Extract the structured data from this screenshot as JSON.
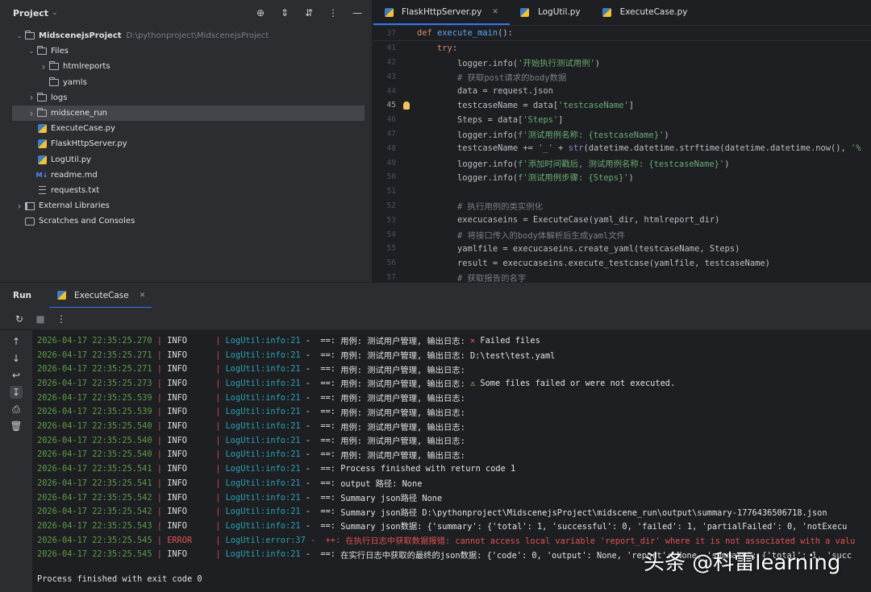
{
  "project": {
    "title": "Project",
    "tree": [
      {
        "label": "MidscenejsProject",
        "path": "D:\\pythonproject\\MidscenejsProject",
        "level": 0,
        "expand": "down",
        "icon": "folder"
      },
      {
        "label": "Files",
        "level": 1,
        "expand": "down",
        "icon": "folder"
      },
      {
        "label": "htmlreports",
        "level": 2,
        "expand": "right",
        "icon": "folder"
      },
      {
        "label": "yamls",
        "level": 2,
        "expand": "none",
        "icon": "folder"
      },
      {
        "label": "logs",
        "level": 1,
        "expand": "right",
        "icon": "folder"
      },
      {
        "label": "midscene_run",
        "level": 1,
        "expand": "right",
        "icon": "folder",
        "selected": true
      },
      {
        "label": "ExecuteCase.py",
        "level": 1,
        "expand": "none",
        "icon": "python"
      },
      {
        "label": "FlaskHttpServer.py",
        "level": 1,
        "expand": "none",
        "icon": "python"
      },
      {
        "label": "LogUtil.py",
        "level": 1,
        "expand": "none",
        "icon": "python"
      },
      {
        "label": "readme.md",
        "level": 1,
        "expand": "none",
        "icon": "markdown"
      },
      {
        "label": "requests.txt",
        "level": 1,
        "expand": "none",
        "icon": "text"
      },
      {
        "label": "External Libraries",
        "level": 0,
        "expand": "right",
        "icon": "library"
      },
      {
        "label": "Scratches and Consoles",
        "level": 0,
        "expand": "none",
        "icon": "scratch"
      }
    ]
  },
  "editor": {
    "tabs": [
      {
        "label": "FlaskHttpServer.py",
        "active": true,
        "closable": true
      },
      {
        "label": "LogUtil.py",
        "active": false,
        "closable": false
      },
      {
        "label": "ExecuteCase.py",
        "active": false,
        "closable": false
      }
    ],
    "sticky": {
      "line": "37",
      "def_kw": "def",
      "fname": "execute_main",
      "rest": "():"
    },
    "lines": [
      {
        "n": "41",
        "code": "    try:"
      },
      {
        "n": "42",
        "code": "        logger.info('开始执行测试用例')"
      },
      {
        "n": "43",
        "code": "        # 获取post请求的body数据"
      },
      {
        "n": "44",
        "code": "        data = request.json"
      },
      {
        "n": "45",
        "code": "        testcaseName = data['testcaseName']",
        "current": true
      },
      {
        "n": "46",
        "code": "        Steps = data['Steps']"
      },
      {
        "n": "47",
        "code": "        logger.info(f'测试用例名称: {testcaseName}')"
      },
      {
        "n": "48",
        "code": "        testcaseName += '_' + str(datetime.datetime.strftime(datetime.datetime.now(), '%"
      },
      {
        "n": "49",
        "code": "        logger.info(f'添加时间戳后, 测试用例名称: {testcaseName}')"
      },
      {
        "n": "50",
        "code": "        logger.info(f'测试用例步骤: {Steps}')"
      },
      {
        "n": "51",
        "code": ""
      },
      {
        "n": "52",
        "code": "        # 执行用例的类实例化"
      },
      {
        "n": "53",
        "code": "        execucaseins = ExecuteCase(yaml_dir, htmlreport_dir)"
      },
      {
        "n": "54",
        "code": "        # 将接口传入的body体解析后生成yaml文件"
      },
      {
        "n": "55",
        "code": "        yamlfile = execucaseins.create_yaml(testcaseName, Steps)"
      },
      {
        "n": "56",
        "code": "        result = execucaseins.execute_testcase(yamlfile, testcaseName)"
      },
      {
        "n": "57",
        "code": "        # 获取报告的名字"
      }
    ]
  },
  "run": {
    "label": "Run",
    "tab": "ExecuteCase",
    "log": [
      {
        "ts": "2026-04-17 22:35:25.270",
        "level": "INFO",
        "loc": "LogUtil:info:21",
        "sep": "-  ==:",
        "msg": "用例: 测试用户管理, 输出日志:",
        "icon": "x",
        "extra": "Failed files"
      },
      {
        "ts": "2026-04-17 22:35:25.271",
        "level": "INFO",
        "loc": "LogUtil:info:21",
        "sep": "-  ==:",
        "msg": "用例: 测试用户管理, 输出日志: D:\\test\\test.yaml"
      },
      {
        "ts": "2026-04-17 22:35:25.271",
        "level": "INFO",
        "loc": "LogUtil:info:21",
        "sep": "-  ==:",
        "msg": "用例: 测试用户管理, 输出日志:"
      },
      {
        "ts": "2026-04-17 22:35:25.273",
        "level": "INFO",
        "loc": "LogUtil:info:21",
        "sep": "-  ==:",
        "msg": "用例: 测试用户管理, 输出日志:",
        "icon": "warn",
        "extra": "Some files failed or were not executed."
      },
      {
        "ts": "2026-04-17 22:35:25.539",
        "level": "INFO",
        "loc": "LogUtil:info:21",
        "sep": "-  ==:",
        "msg": "用例: 测试用户管理, 输出日志:"
      },
      {
        "ts": "2026-04-17 22:35:25.539",
        "level": "INFO",
        "loc": "LogUtil:info:21",
        "sep": "-  ==:",
        "msg": "用例: 测试用户管理, 输出日志:"
      },
      {
        "ts": "2026-04-17 22:35:25.540",
        "level": "INFO",
        "loc": "LogUtil:info:21",
        "sep": "-  ==:",
        "msg": "用例: 测试用户管理, 输出日志:"
      },
      {
        "ts": "2026-04-17 22:35:25.540",
        "level": "INFO",
        "loc": "LogUtil:info:21",
        "sep": "-  ==:",
        "msg": "用例: 测试用户管理, 输出日志:"
      },
      {
        "ts": "2026-04-17 22:35:25.540",
        "level": "INFO",
        "loc": "LogUtil:info:21",
        "sep": "-  ==:",
        "msg": "用例: 测试用户管理, 输出日志:"
      },
      {
        "ts": "2026-04-17 22:35:25.541",
        "level": "INFO",
        "loc": "LogUtil:info:21",
        "sep": "-  ==:",
        "msg": "Process finished with return code 1"
      },
      {
        "ts": "2026-04-17 22:35:25.541",
        "level": "INFO",
        "loc": "LogUtil:info:21",
        "sep": "-  ==:",
        "msg": "output 路径: None"
      },
      {
        "ts": "2026-04-17 22:35:25.542",
        "level": "INFO",
        "loc": "LogUtil:info:21",
        "sep": "-  ==:",
        "msg": "Summary json路径 None"
      },
      {
        "ts": "2026-04-17 22:35:25.542",
        "level": "INFO",
        "loc": "LogUtil:info:21",
        "sep": "-  ==:",
        "msg": "Summary json路径 D:\\pythonproject\\MidscenejsProject\\midscene_run\\output\\summary-1776436506718.json"
      },
      {
        "ts": "2026-04-17 22:35:25.543",
        "level": "INFO",
        "loc": "LogUtil:info:21",
        "sep": "-  ==:",
        "msg": "Summary json数据: {'summary': {'total': 1, 'successful': 0, 'failed': 1, 'partialFailed': 0, 'notExecu"
      },
      {
        "ts": "2026-04-17 22:35:25.545",
        "level": "ERROR",
        "loc": "LogUtil:error:37",
        "sep": "-  ++:",
        "msg": "在执行日志中获取数据报错: cannot access local variable 'report_dir' where it is not associated with a valu"
      },
      {
        "ts": "2026-04-17 22:35:25.545",
        "level": "INFO",
        "loc": "LogUtil:info:21",
        "sep": "-  ==:",
        "msg": "在实行日志中获取的最终的json数据: {'code': 0, 'output': None, 'report': None, 'summary': {'total': 1, 'succ"
      }
    ],
    "exit": "Process finished with exit code 0"
  },
  "watermark": "头条 @科雷learning",
  "colors": {
    "accent": "#3574f0",
    "timestamp": "#5e9c48",
    "location": "#2aa1b3",
    "error": "#e05252"
  }
}
